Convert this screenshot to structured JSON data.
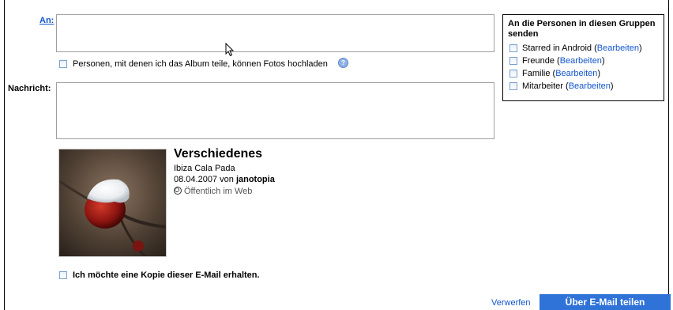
{
  "form": {
    "to_label": "An:",
    "to_value": "",
    "upload_permission_label": "Personen, mit denen ich das Album teile, können Fotos hochladen",
    "help_icon_symbol": "?",
    "message_label": "Nachricht:",
    "message_value": ""
  },
  "groups": {
    "title": "An die Personen in diesen Gruppen senden",
    "edit_label": "Bearbeiten",
    "items": [
      {
        "name": "Starred in Android"
      },
      {
        "name": "Freunde"
      },
      {
        "name": "Familie"
      },
      {
        "name": "Mitarbeiter"
      }
    ]
  },
  "album": {
    "title": "Verschiedenes",
    "subtitle": "Ibiza Cala Pada",
    "date": "08.04.2007",
    "by": "von",
    "author": "janotopia",
    "visibility": "Öffentlich im Web",
    "visibility_icon": "globe-icon"
  },
  "footer": {
    "copy_label": "Ich möchte eine Kopie dieser E-Mail erhalten.",
    "discard_label": "Verwerfen",
    "share_button_label": "Über E-Mail teilen"
  },
  "colors": {
    "link": "#1155cc",
    "primary_button": "#2f72d8"
  }
}
